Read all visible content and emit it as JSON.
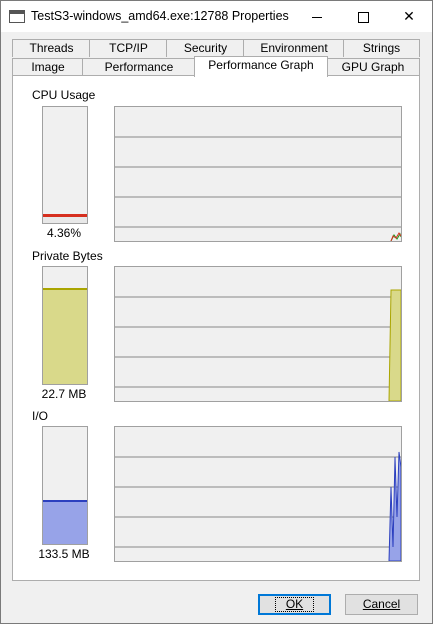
{
  "window": {
    "title": "TestS3-windows_amd64.exe:12788 Properties",
    "controls": {
      "minimize": "minimize",
      "maximize": "maximize",
      "close": "✕"
    }
  },
  "tabs": {
    "row_back": [
      {
        "label": "Threads"
      },
      {
        "label": "TCP/IP"
      },
      {
        "label": "Security"
      },
      {
        "label": "Environment"
      },
      {
        "label": "Strings"
      }
    ],
    "row_front": [
      {
        "label": "Image"
      },
      {
        "label": "Performance"
      },
      {
        "label": "Performance Graph",
        "active": true
      },
      {
        "label": "GPU Graph"
      }
    ]
  },
  "sections": {
    "cpu": {
      "label": "CPU Usage",
      "value": "4.36%",
      "fill_fraction": 0.0436,
      "color": "#d62f1f",
      "fill_color": "#f0f0f0"
    },
    "private_bytes": {
      "label": "Private Bytes",
      "value": "22.7 MB",
      "fill_fraction": 0.8,
      "color": "#aaa500",
      "fill_color": "#d9d98a"
    },
    "io": {
      "label": "I/O",
      "value": "133.5  MB",
      "fill_fraction": 0.36,
      "color": "#2b3fbf",
      "fill_color": "#97a3e8"
    }
  },
  "buttons": {
    "ok": "OK",
    "cancel": "Cancel"
  }
}
